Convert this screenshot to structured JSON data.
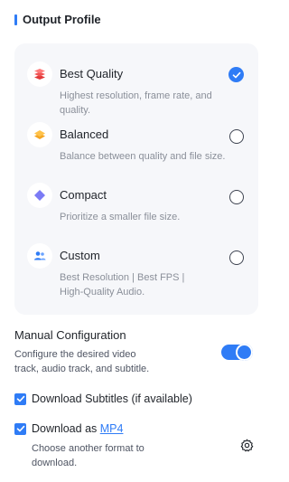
{
  "header": {
    "title": "Output Profile"
  },
  "profiles": [
    {
      "title": "Best Quality",
      "desc": "Highest resolution, frame rate, and quality.",
      "icon": "stack-layers-icon",
      "selected": true
    },
    {
      "title": "Balanced",
      "desc": "Balance between quality and file size.",
      "icon": "diamond-layer-icon",
      "selected": false
    },
    {
      "title": "Compact",
      "desc": "Prioritize a smaller file size.",
      "icon": "diamond-icon",
      "selected": false
    },
    {
      "title": "Custom",
      "desc": "Best Resolution | Best FPS | High-Quality Audio.",
      "icon": "users-icon",
      "selected": false
    }
  ],
  "manual": {
    "title": "Manual Configuration",
    "desc": "Configure the desired video track, audio track, and subtitle.",
    "enabled": true
  },
  "subtitles": {
    "label": "Download Subtitles (if available)",
    "checked": true
  },
  "download": {
    "prefix": "Download as ",
    "format": "MP4",
    "desc": "Choose another format to download.",
    "checked": true
  },
  "colors": {
    "accent": "#2f7cf6",
    "card_bg": "#f6f7fa"
  }
}
